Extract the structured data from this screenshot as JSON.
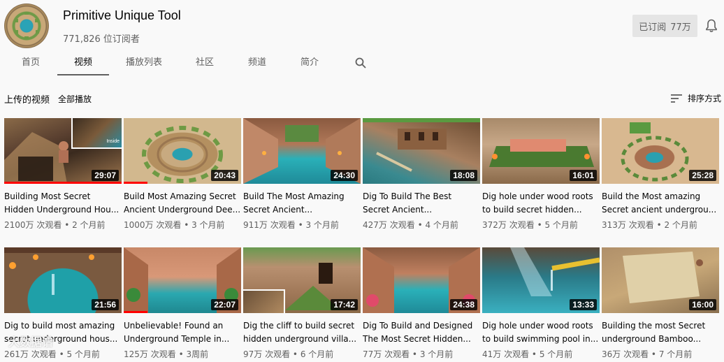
{
  "channel": {
    "name": "Primitive Unique Tool",
    "subscribers": "771,826 位订阅者",
    "subscribe_label": "已订阅",
    "subscribe_count": "77万"
  },
  "tabs": [
    {
      "label": "首页"
    },
    {
      "label": "视频"
    },
    {
      "label": "播放列表"
    },
    {
      "label": "社区"
    },
    {
      "label": "频道"
    },
    {
      "label": "简介"
    }
  ],
  "section": {
    "title": "上传的视频",
    "play_all": "全部播放",
    "sort_label": "排序方式"
  },
  "videos": [
    {
      "title": "Building Most Secret Hidden Underground Hou...",
      "views": "2100万 次观看",
      "age": "2 个月前",
      "duration": "29:07",
      "progress": 1.0,
      "inset": "Inside"
    },
    {
      "title": "Build Most Amazing Secret Ancient Underground Dee...",
      "views": "1000万 次观看",
      "age": "3 个月前",
      "duration": "20:43",
      "progress": 0.2
    },
    {
      "title": "Build The Most Amazing Secret Ancient...",
      "views": "911万 次观看",
      "age": "3 个月前",
      "duration": "24:30",
      "progress": 0
    },
    {
      "title": "Dig To Build The Best Secret Ancient...",
      "views": "427万 次观看",
      "age": "4 个月前",
      "duration": "18:08",
      "progress": 0
    },
    {
      "title": "Dig hole under wood roots to build secret hidden...",
      "views": "372万 次观看",
      "age": "5 个月前",
      "duration": "16:01",
      "progress": 0
    },
    {
      "title": "Build the Most amazing Secret ancient undergrou...",
      "views": "313万 次观看",
      "age": "2 个月前",
      "duration": "25:28",
      "progress": 0
    },
    {
      "title": "Dig to build most amazing secret underground hous...",
      "views": "261万 次观看",
      "age": "5 个月前",
      "duration": "21:56",
      "progress": 0
    },
    {
      "title": "Unbelievable! Found an Underground Temple in...",
      "views": "125万 次观看",
      "age": "3周前",
      "duration": "22:07",
      "progress": 0.2
    },
    {
      "title": "Dig the cliff to build secret hidden underground villa...",
      "views": "97万 次观看",
      "age": "6 个月前",
      "duration": "17:42",
      "progress": 0
    },
    {
      "title": "Dig To Build and Designed The Most Secret Hidden...",
      "views": "77万 次观看",
      "age": "3 个月前",
      "duration": "24:38",
      "progress": 0
    },
    {
      "title": "Dig hole under wood roots to build swimming pool in...",
      "views": "41万 次观看",
      "age": "5 个月前",
      "duration": "13:33",
      "progress": 0
    },
    {
      "title": "Building the most Secret underground Bamboo...",
      "views": "36万 次观看",
      "age": "7 个月前",
      "duration": "16:00",
      "progress": 0
    }
  ],
  "watermark": "大数据谱",
  "meta_separator": "•"
}
